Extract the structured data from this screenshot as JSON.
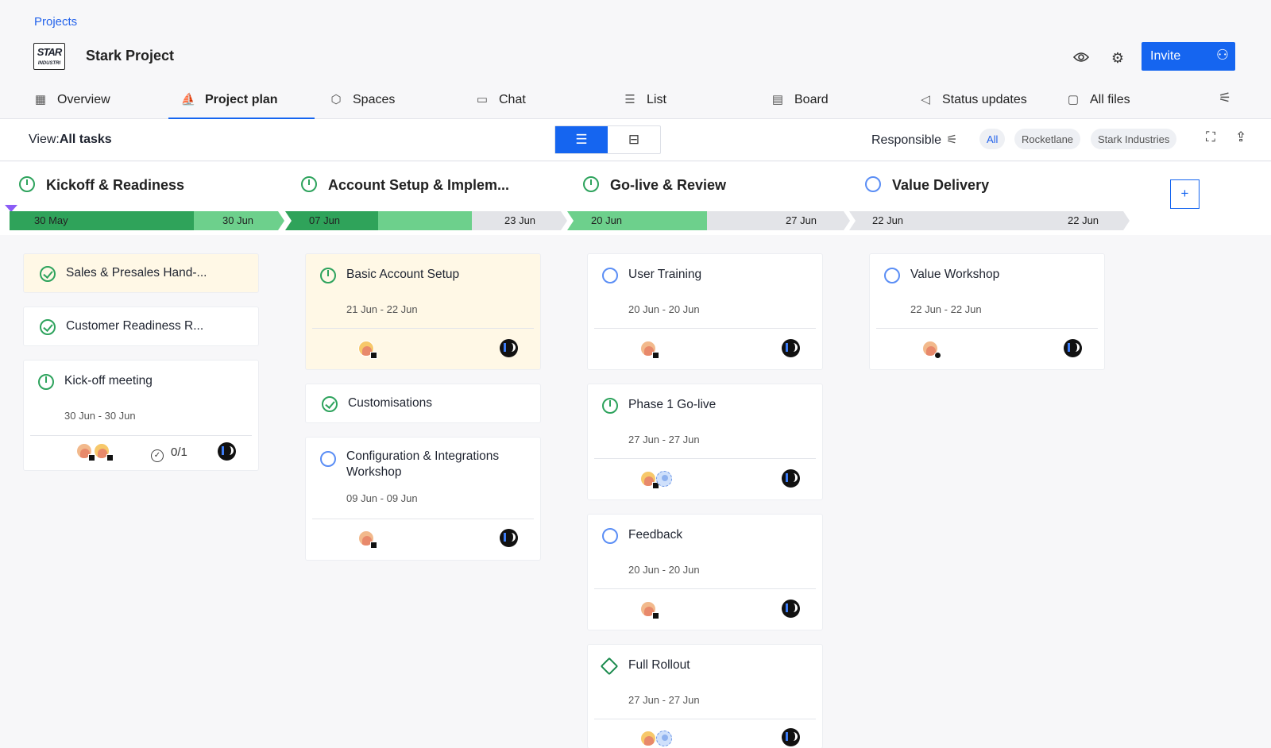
{
  "breadcrumb": "Projects",
  "project": {
    "logo_line1": "STAR",
    "logo_line2": "INDUSTRI",
    "title": "Stark Project"
  },
  "header": {
    "invite_label": "Invite",
    "view_icon": "eye-icon",
    "settings_icon": "gear-icon",
    "invite_icon": "users-icon"
  },
  "tabs": [
    {
      "label": "Overview",
      "icon": "overview-icon"
    },
    {
      "label": "Project plan",
      "icon": "plan-icon"
    },
    {
      "label": "Spaces",
      "icon": "spaces-icon"
    },
    {
      "label": "Chat",
      "icon": "chat-icon"
    },
    {
      "label": "List",
      "icon": "list-icon"
    },
    {
      "label": "Board",
      "icon": "board-icon"
    },
    {
      "label": "Status updates",
      "icon": "megaphone-icon"
    },
    {
      "label": "All files",
      "icon": "folder-icon"
    }
  ],
  "toolbar": {
    "view_prefix": "View:",
    "view_value": "All tasks",
    "responsible_label": "Responsible",
    "chips": [
      "All",
      "Rocketlane",
      "Stark Industries"
    ],
    "selected_chip": "All"
  },
  "phases": [
    {
      "name": "Kickoff & Readiness",
      "status": "in-progress",
      "start": "30 May",
      "end": "30 Jun"
    },
    {
      "name": "Account Setup & Implem...",
      "status": "in-progress",
      "start": "07 Jun",
      "end": "23 Jun"
    },
    {
      "name": "Go-live & Review",
      "status": "in-progress",
      "start": "20 Jun",
      "end": "27 Jun"
    },
    {
      "name": "Value Delivery",
      "status": "not-started",
      "start": "22 Jun",
      "end": "22 Jun"
    }
  ],
  "add_phase_label": "+",
  "tasks": {
    "c1": [
      {
        "title": "Sales & Presales Hand-...",
        "status": "done"
      },
      {
        "title": "Customer Readiness R...",
        "status": "done"
      },
      {
        "title": "Kick-off meeting",
        "status": "in-progress",
        "dates": "30 Jun - 30 Jun",
        "subtasks": "0/1"
      }
    ],
    "c2": [
      {
        "title": "Basic Account Setup",
        "status": "in-progress",
        "dates": "21 Jun - 22 Jun"
      },
      {
        "title": "Customisations",
        "status": "done"
      },
      {
        "title": "Configuration & Integrations Workshop",
        "status": "not-started",
        "dates": "09 Jun - 09 Jun"
      }
    ],
    "c3": [
      {
        "title": "User Training",
        "status": "not-started",
        "dates": "20 Jun - 20 Jun"
      },
      {
        "title": "Phase 1 Go-live",
        "status": "in-progress",
        "dates": "27 Jun - 27 Jun"
      },
      {
        "title": "Feedback",
        "status": "not-started",
        "dates": "20 Jun - 20 Jun"
      },
      {
        "title": "Full Rollout",
        "status": "milestone",
        "dates": "27 Jun - 27 Jun"
      }
    ],
    "c4": [
      {
        "title": "Value Workshop",
        "status": "not-started",
        "dates": "22 Jun - 22 Jun"
      }
    ]
  },
  "colors": {
    "accent": "#1565f0",
    "done_green": "#2ea35d",
    "progress_dark": "#2fa35a",
    "progress_light": "#6dd08c",
    "pending_gray": "#e3e4e8",
    "highlight_card": "#fff8e6"
  }
}
